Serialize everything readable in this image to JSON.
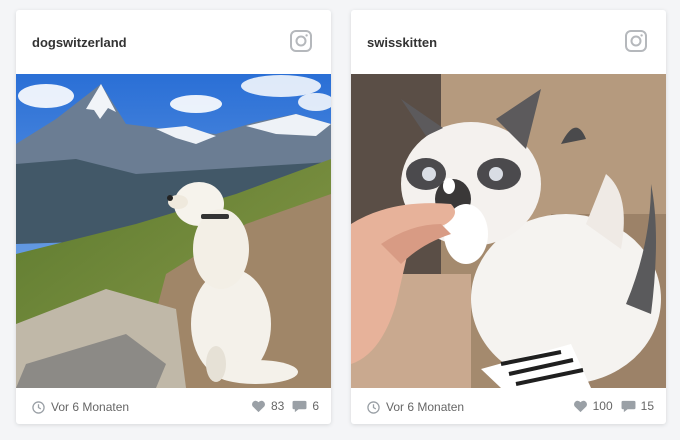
{
  "colors": {
    "icon": "#9aa0a6",
    "text": "#666666",
    "username": "#333333"
  },
  "posts": [
    {
      "username": "dogswitzerland",
      "photo_subject": "white dog sitting on mountain trail facing snowy peak",
      "time": "Vor 6 Monaten",
      "likes": "83",
      "comments": "6",
      "icons": {
        "platform": "instagram-icon",
        "time": "clock-icon",
        "likes": "heart-icon",
        "comments": "comment-icon"
      }
    },
    {
      "username": "swisskitten",
      "photo_subject": "ragdoll kitten pawing at hand holding a treat",
      "time": "Vor 6 Monaten",
      "likes": "100",
      "comments": "15",
      "icons": {
        "platform": "instagram-icon",
        "time": "clock-icon",
        "likes": "heart-icon",
        "comments": "comment-icon"
      }
    }
  ]
}
